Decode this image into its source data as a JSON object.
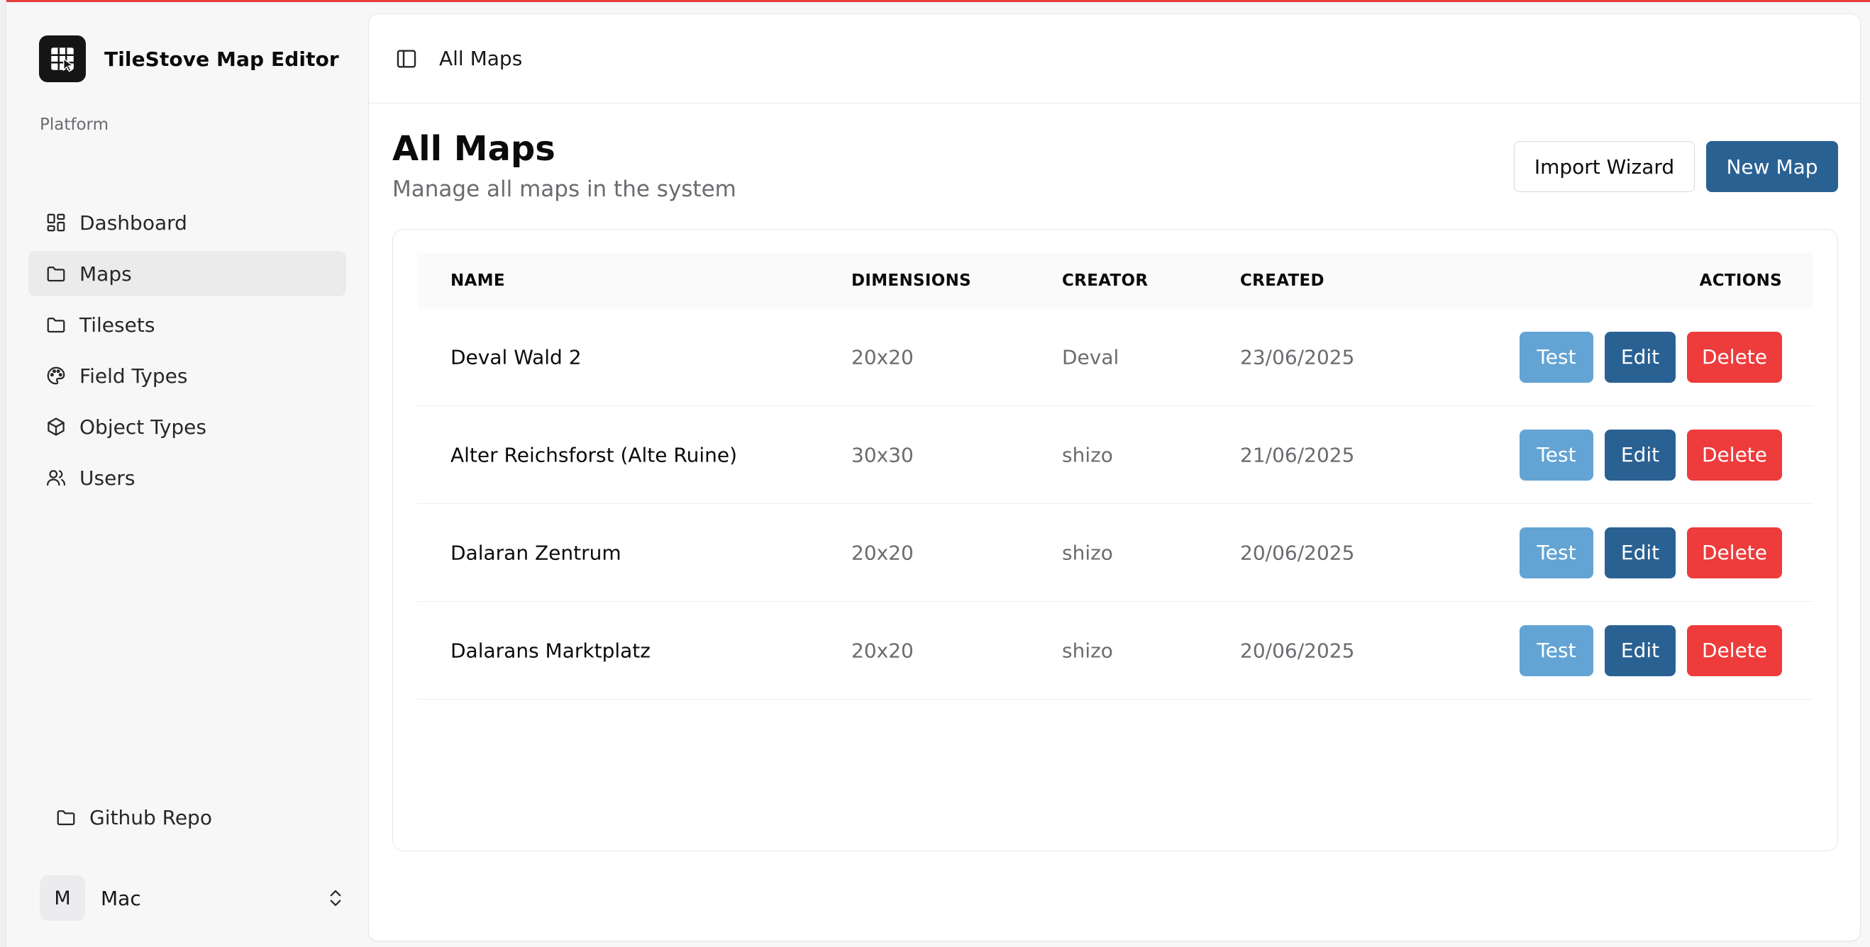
{
  "app": {
    "name": "TileStove Map Editor"
  },
  "sidebar": {
    "group_label": "Platform",
    "items": [
      {
        "label": "Dashboard",
        "icon": "grid-icon"
      },
      {
        "label": "Maps",
        "icon": "folder-icon",
        "active": true
      },
      {
        "label": "Tilesets",
        "icon": "folder-icon"
      },
      {
        "label": "Field Types",
        "icon": "palette-icon"
      },
      {
        "label": "Object Types",
        "icon": "cube-icon"
      },
      {
        "label": "Users",
        "icon": "users-icon"
      }
    ],
    "repo_link": "Github Repo",
    "user": {
      "initial": "M",
      "name": "Mac"
    }
  },
  "header": {
    "breadcrumb": "All Maps"
  },
  "page": {
    "title": "All Maps",
    "subtitle": "Manage all maps in the system",
    "import_label": "Import Wizard",
    "new_label": "New Map"
  },
  "table": {
    "columns": [
      "NAME",
      "DIMENSIONS",
      "CREATOR",
      "CREATED",
      "ACTIONS"
    ],
    "rows": [
      {
        "name": "Deval Wald 2",
        "dimensions": "20x20",
        "creator": "Deval",
        "created": "23/06/2025"
      },
      {
        "name": "Alter Reichsforst (Alte Ruine)",
        "dimensions": "30x30",
        "creator": "shizo",
        "created": "21/06/2025"
      },
      {
        "name": "Dalaran Zentrum",
        "dimensions": "20x20",
        "creator": "shizo",
        "created": "20/06/2025"
      },
      {
        "name": "Dalarans Marktplatz",
        "dimensions": "20x20",
        "creator": "shizo",
        "created": "20/06/2025"
      }
    ],
    "actions": {
      "test": "Test",
      "edit": "Edit",
      "delete": "Delete"
    }
  },
  "colors": {
    "primary": "#2a6193",
    "test": "#63a4d4",
    "danger": "#ee3b3b",
    "active_nav": "#ebebec"
  }
}
